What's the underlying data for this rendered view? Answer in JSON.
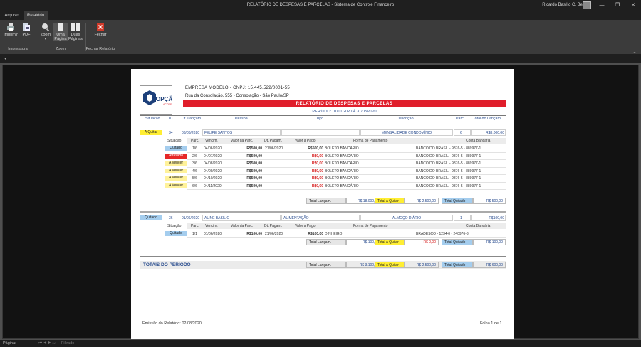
{
  "window": {
    "title": "RELATÓRIO DE DESPESAS E PARCELAS  -  Sistema de Controle Financeiro",
    "user": "Ricardo Basilio C. Belucci",
    "controls": [
      "—",
      "❐",
      "✕"
    ]
  },
  "tabs": [
    {
      "label": "Arquivo"
    },
    {
      "label": "Relatório"
    }
  ],
  "ribbon": {
    "print": "Imprimir",
    "pdf": "PDF",
    "zoom": "Zoom",
    "zoom_arrow": "▾",
    "one_page_1": "Uma",
    "one_page_2": "Página",
    "two_pages_1": "Duas",
    "two_pages_2": "Páginas",
    "close": "Fechar",
    "group_print": "Impressora",
    "group_zoom": "Zoom",
    "group_close": "Fechar Relatório"
  },
  "qat": "▾",
  "collapse": "︿",
  "status": {
    "page_label": "Página:",
    "nav": "⏮ ◀ ▶ ⏭",
    "filter": "Filtrado"
  },
  "report": {
    "company": "EMPRESA MODELO - CNPJ: 15.445.522/0001-55",
    "address": "Rua da Consolação, 555 - Consolação - São Paulo/SP",
    "logo_text": "OPÇÃO",
    "logo_sub": "ACCESS",
    "title": "RELATÓRIO DE DESPESAS E PARCELAS",
    "period": "PERÍODO: 01/01/2020 À 31/08/2020",
    "headers": {
      "situacao": "Situação",
      "id": "ID",
      "dt": "Dt. Lançam.",
      "pessoa": "Pessoa",
      "tipo": "Tipo",
      "descricao": "Descrição",
      "parc": "Parc.",
      "total": "Total do Lançam."
    },
    "sub_headers": {
      "situacao": "Situação",
      "parc": "Parc.",
      "venc": "Vencim.",
      "valor": "Valor da Parc.",
      "dtpag": "Dt. Pagam.",
      "pago": "Valor a Pago",
      "forma": "Forma de Pagamento",
      "conta": "Conta Bancária"
    },
    "totals_labels": {
      "lanc": "Total Lançam.",
      "quitar": "Total a Quitar",
      "quitado": "Total Quitado"
    },
    "entries": [
      {
        "situacao": "A Quitar",
        "id": "34",
        "dt": "03/06/2020",
        "pessoa": "FELIPE SANTOS",
        "tipo": "",
        "descricao": "MENSALIDADE CONDOMÍNIO",
        "parc": "6",
        "total": "R$3.000,00",
        "installments": [
          {
            "situacao": "Quitado",
            "parc": "1/6",
            "venc": "04/06/2020",
            "valor": "R$500,00",
            "dtpag": "21/06/2020",
            "pago": "R$500,00",
            "forma": "BOLETO BANCÁRIO",
            "conta": "BANCO DO BRASIL - 9876-5 - 889977-1"
          },
          {
            "situacao": "Atrasado",
            "parc": "2/6",
            "venc": "04/07/2020",
            "valor": "R$500,00",
            "dtpag": "",
            "pago": "R$0,00",
            "forma": "BOLETO BANCÁRIO",
            "conta": "BANCO DO BRASIL - 9876-5 - 889977-1"
          },
          {
            "situacao": "A Vencer",
            "parc": "3/6",
            "venc": "04/08/2020",
            "valor": "R$500,00",
            "dtpag": "",
            "pago": "R$0,00",
            "forma": "BOLETO BANCÁRIO",
            "conta": "BANCO DO BRASIL - 9876-5 - 889977-1"
          },
          {
            "situacao": "A Vencer",
            "parc": "4/6",
            "venc": "04/09/2020",
            "valor": "R$500,00",
            "dtpag": "",
            "pago": "R$0,00",
            "forma": "BOLETO BANCÁRIO",
            "conta": "BANCO DO BRASIL - 9876-5 - 889977-1"
          },
          {
            "situacao": "A Vencer",
            "parc": "5/6",
            "venc": "04/10/2020",
            "valor": "R$500,00",
            "dtpag": "",
            "pago": "R$0,00",
            "forma": "BOLETO BANCÁRIO",
            "conta": "BANCO DO BRASIL - 9876-5 - 889977-1"
          },
          {
            "situacao": "A Vencer",
            "parc": "6/6",
            "venc": "04/11/2020",
            "valor": "R$500,00",
            "dtpag": "",
            "pago": "R$0,00",
            "forma": "BOLETO BANCÁRIO",
            "conta": "BANCO DO BRASIL - 9876-5 - 889977-1"
          }
        ],
        "totals": {
          "lanc": "R$ 18.000,00",
          "quitar": "R$ 2.500,00",
          "quitado": "R$ 500,00"
        }
      },
      {
        "situacao": "Quitado",
        "id": "36",
        "dt": "01/06/2020",
        "pessoa": "ALINE BASILIO",
        "tipo": "ALIMENTAÇÃO",
        "descricao": "ALMOÇO DIÁRIO",
        "parc": "1",
        "total": "R$100,00",
        "installments": [
          {
            "situacao": "Quitado",
            "parc": "1/1",
            "venc": "01/06/2020",
            "valor": "R$100,00",
            "dtpag": "21/06/2020",
            "pago": "R$100,00",
            "forma": "DINHEIRO",
            "conta": "BRADESCO - 1234-0 - 240976-3"
          }
        ],
        "totals": {
          "lanc": "R$ 100,00",
          "quitar": "R$ 0,00",
          "quitado": "R$ 100,00"
        }
      }
    ],
    "period_totals": {
      "label": "TOTAIS DO PERÍODO",
      "lanc": "R$ 3.100,00",
      "quitar": "R$ 2.500,00",
      "quitado": "R$ 600,00"
    },
    "footer": {
      "emissao": "Emissão do Relatório: 02/08/2020",
      "folha": "Folha 1 de 1"
    }
  },
  "colors": {
    "accent": "#e01e2b",
    "quitado": "#a4cdee",
    "a_quitar": "#ffee33",
    "atrasado": "#e62828",
    "a_vencer": "#fff29a"
  }
}
